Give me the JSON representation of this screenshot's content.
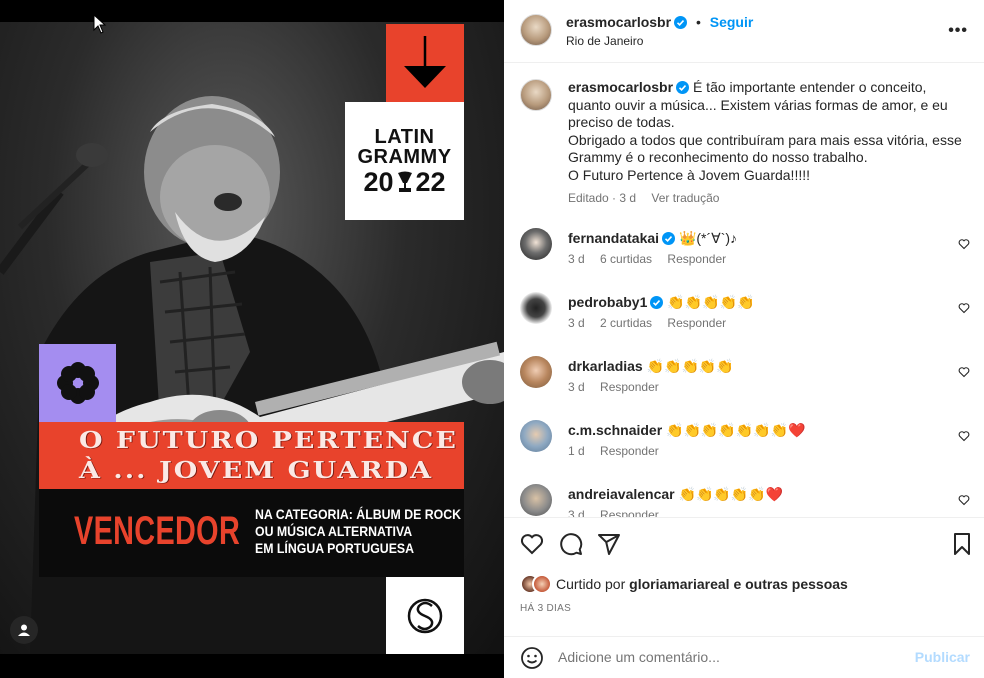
{
  "post_image": {
    "grammy_line1": "LATIN",
    "grammy_line2": "GRAMMY",
    "grammy_year_a": "20",
    "grammy_year_b": "22",
    "title_line1": "O FUTURO PERTENCE",
    "title_line2": "À ... JOVEM GUARDA",
    "winner": "VENCEDOR",
    "category_line1": "NA CATEGORIA: ÁLBUM DE ROCK",
    "category_line2": "OU MÚSICA ALTERNATIVA",
    "category_line3": "EM LÍNGUA PORTUGUESA"
  },
  "header": {
    "username": "erasmocarlosbr",
    "separator": "•",
    "follow_label": "Seguir",
    "location": "Rio de Janeiro",
    "more_label": "•••"
  },
  "caption": {
    "username": "erasmocarlosbr",
    "line1": "É tão importante entender o conceito, quanto ouvir a música... Existem várias formas de amor, e eu preciso de todas.",
    "line2": "Obrigado a todos que contribuíram para mais essa vitória, esse Grammy é o reconhecimento do nosso trabalho.",
    "line3": "O Futuro Pertence à Jovem Guarda!!!!!",
    "edited": "Editado · 3 d",
    "translate": "Ver tradução"
  },
  "comments": [
    {
      "username": "fernandatakai",
      "verified": true,
      "text": "👑(*´∀`)♪",
      "time": "3 d",
      "likes": "6 curtidas",
      "reply": "Responder"
    },
    {
      "username": "pedrobaby1",
      "verified": true,
      "text": "👏👏👏👏👏",
      "time": "3 d",
      "likes": "2 curtidas",
      "reply": "Responder"
    },
    {
      "username": "drkarladias",
      "verified": false,
      "text": "👏👏👏👏👏",
      "time": "3 d",
      "likes": "",
      "reply": "Responder"
    },
    {
      "username": "c.m.schnaider",
      "verified": false,
      "text": "👏👏👏👏👏👏👏❤️",
      "time": "1 d",
      "likes": "",
      "reply": "Responder"
    },
    {
      "username": "andreiavalencar",
      "verified": false,
      "text": "👏👏👏👏👏❤️",
      "time": "3 d",
      "likes": "",
      "reply": "Responder"
    }
  ],
  "likes": {
    "prefix": "Curtido por",
    "user": "gloriamariareal",
    "suffix": "e outras pessoas"
  },
  "posted_ago": "HÁ 3 DIAS",
  "add_comment": {
    "placeholder": "Adicione um comentário...",
    "publish_label": "Publicar"
  },
  "colors": {
    "accent_blue": "#0095f6",
    "poster_red": "#e8432c",
    "poster_lilac": "#a48df0"
  }
}
